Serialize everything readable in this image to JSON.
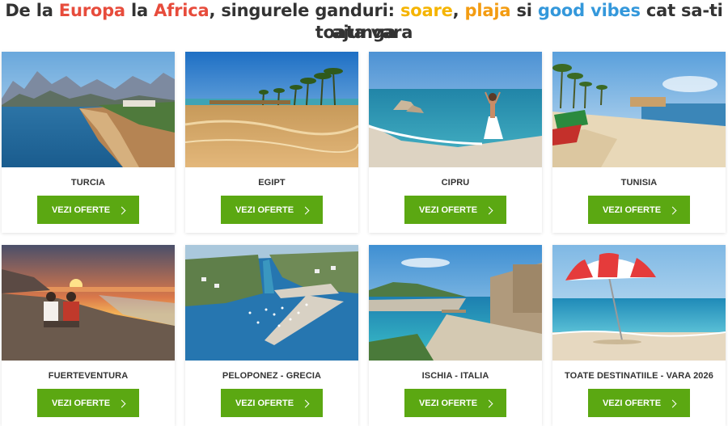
{
  "headline": {
    "w1": "De la ",
    "w2": "Europa",
    "w3": " la ",
    "w4": "Africa",
    "w5": ", singurele ganduri: ",
    "w6": "soare",
    "w7": ", ",
    "w8": "plaja",
    "w9": " si ",
    "w10": "good vibes",
    "w11": " cat sa-ti ajunga",
    "line2": "toata vara"
  },
  "cards": [
    {
      "title": "TURCIA",
      "button": "VEZI OFERTE"
    },
    {
      "title": "EGIPT",
      "button": "VEZI OFERTE"
    },
    {
      "title": "CIPRU",
      "button": "VEZI OFERTE"
    },
    {
      "title": "TUNISIA",
      "button": "VEZI OFERTE"
    },
    {
      "title": "FUERTEVENTURA",
      "button": "VEZI OFERTE"
    },
    {
      "title": "PELOPONEZ - GRECIA",
      "button": "VEZI OFERTE"
    },
    {
      "title": "ISCHIA - ITALIA",
      "button": "VEZI OFERTE"
    },
    {
      "title": "TOATE DESTINATIILE - VARA 2026",
      "button": "VEZI OFERTE"
    }
  ],
  "colors": {
    "accent_red": "#e74c3c",
    "accent_yellow": "#f5b400",
    "accent_orange": "#f39c12",
    "accent_blue": "#3498db",
    "button_green": "#5ba812"
  },
  "icons": {
    "button_arrow": "chevron-right-icon"
  }
}
